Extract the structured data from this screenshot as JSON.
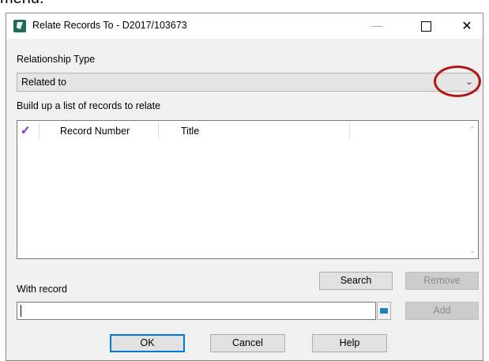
{
  "page": {
    "top_text_fragment": "menu."
  },
  "window": {
    "title": "Relate Records To - D2017/103673",
    "minimize": "—",
    "close": "✕",
    "maximize_icon": "maximize-square"
  },
  "relationship": {
    "label": "Relationship Type",
    "value": "Related to",
    "arrow": "⌄"
  },
  "list": {
    "label": "Build up a list of records to relate",
    "columns": {
      "check": "✓",
      "record_number": "Record Number",
      "title": "Title"
    },
    "rows": [],
    "scroll_up": "⌃",
    "scroll_down": "⌄"
  },
  "with_record": {
    "label": "With record",
    "value": "",
    "browse_icon": "folder-icon"
  },
  "buttons": {
    "search": "Search",
    "remove": "Remove",
    "add": "Add",
    "ok": "OK",
    "cancel": "Cancel",
    "help": "Help"
  },
  "colors": {
    "highlight_ring": "#b01818",
    "check_mark": "#7a2ad0",
    "default_button_border": "#0078d7"
  }
}
